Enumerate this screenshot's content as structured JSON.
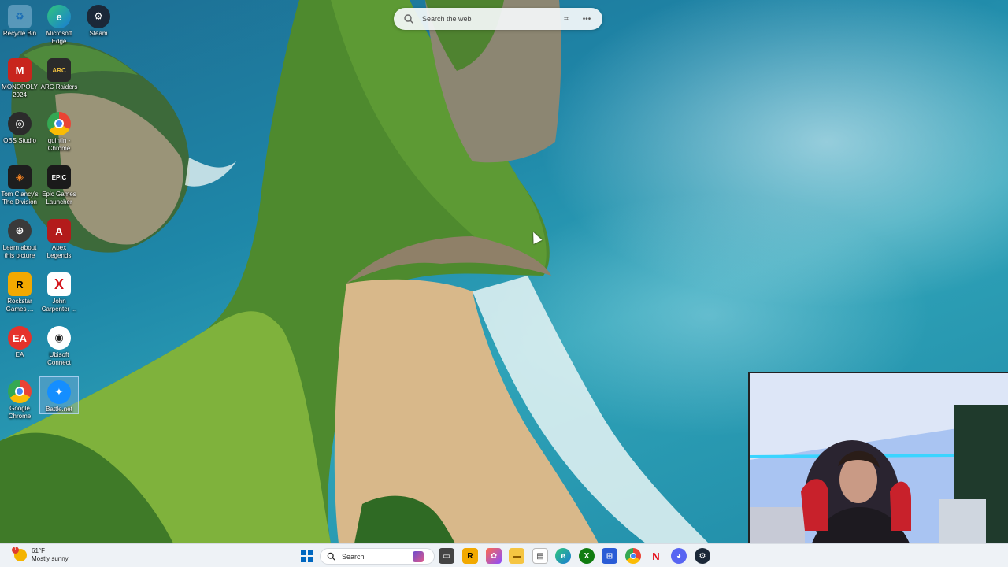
{
  "desktop": {
    "icons": [
      {
        "label": "Recycle Bin",
        "icon": "recycle-bin-icon"
      },
      {
        "label": "Microsoft\nEdge",
        "icon": "edge-icon"
      },
      {
        "label": "Steam",
        "icon": "steam-icon"
      },
      {
        "label": "MONOPOLY\n2024",
        "icon": "monopoly-icon"
      },
      {
        "label": "ARC Raiders",
        "icon": "arc-raiders-icon"
      },
      {
        "label": "OBS Studio",
        "icon": "obs-icon"
      },
      {
        "label": "quintin -\nChrome",
        "icon": "chrome-profile-icon"
      },
      {
        "label": "Tom Clancy's\nThe Division",
        "icon": "division-icon"
      },
      {
        "label": "Epic Games\nLauncher",
        "icon": "epic-games-icon"
      },
      {
        "label": "Learn about\nthis picture",
        "icon": "learn-picture-icon"
      },
      {
        "label": "Apex\nLegends",
        "icon": "apex-icon"
      },
      {
        "label": "Rockstar\nGames ...",
        "icon": "rockstar-icon"
      },
      {
        "label": "John\nCarpenter ...",
        "icon": "john-carpenter-icon"
      },
      {
        "label": "EA",
        "icon": "ea-icon"
      },
      {
        "label": "Ubisoft\nConnect",
        "icon": "ubisoft-icon"
      },
      {
        "label": "Google\nChrome",
        "icon": "chrome-icon"
      },
      {
        "label": "Battle.net",
        "icon": "battlenet-icon"
      }
    ]
  },
  "search": {
    "placeholder": "Search the web"
  },
  "taskbar": {
    "weather_temp": "61°F",
    "weather_desc": "Mostly sunny",
    "weather_badge": "1",
    "search_placeholder": "Search",
    "apps": [
      "start-icon",
      "search-icon",
      "widget-icon",
      "task-view-icon",
      "rockstar-icon",
      "photos-icon",
      "file-explorer-icon",
      "notepad-icon",
      "edge-icon",
      "xbox-icon",
      "store-icon",
      "chrome-icon",
      "netflix-icon",
      "discord-icon",
      "steam-icon"
    ]
  },
  "colors": {
    "taskbar_bg": "#eef2f6",
    "accent": "#0067c0"
  }
}
